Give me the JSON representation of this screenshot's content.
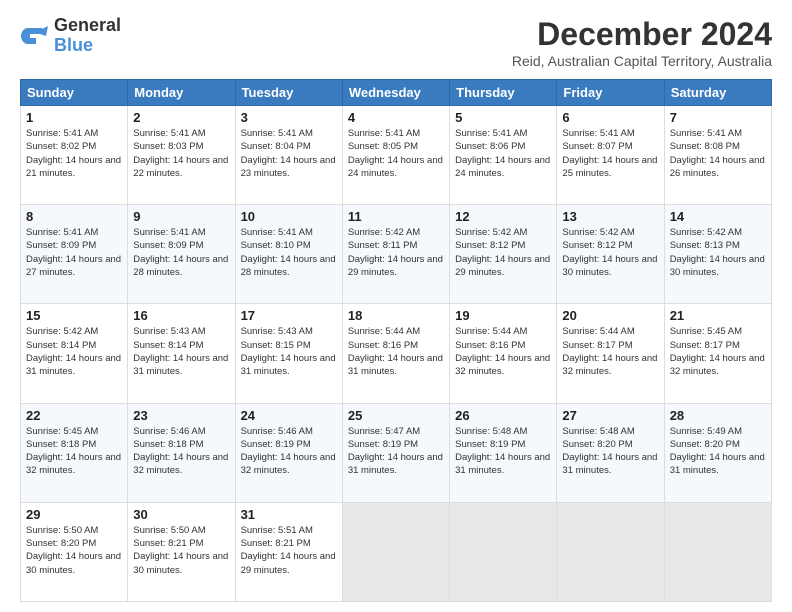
{
  "header": {
    "logo_line1": "General",
    "logo_line2": "Blue",
    "main_title": "December 2024",
    "subtitle": "Reid, Australian Capital Territory, Australia"
  },
  "calendar": {
    "days_of_week": [
      "Sunday",
      "Monday",
      "Tuesday",
      "Wednesday",
      "Thursday",
      "Friday",
      "Saturday"
    ],
    "weeks": [
      [
        {
          "day": "1",
          "sunrise": "5:41 AM",
          "sunset": "8:02 PM",
          "daylight": "14 hours and 21 minutes."
        },
        {
          "day": "2",
          "sunrise": "5:41 AM",
          "sunset": "8:03 PM",
          "daylight": "14 hours and 22 minutes."
        },
        {
          "day": "3",
          "sunrise": "5:41 AM",
          "sunset": "8:04 PM",
          "daylight": "14 hours and 23 minutes."
        },
        {
          "day": "4",
          "sunrise": "5:41 AM",
          "sunset": "8:05 PM",
          "daylight": "14 hours and 24 minutes."
        },
        {
          "day": "5",
          "sunrise": "5:41 AM",
          "sunset": "8:06 PM",
          "daylight": "14 hours and 24 minutes."
        },
        {
          "day": "6",
          "sunrise": "5:41 AM",
          "sunset": "8:07 PM",
          "daylight": "14 hours and 25 minutes."
        },
        {
          "day": "7",
          "sunrise": "5:41 AM",
          "sunset": "8:08 PM",
          "daylight": "14 hours and 26 minutes."
        }
      ],
      [
        {
          "day": "8",
          "sunrise": "5:41 AM",
          "sunset": "8:09 PM",
          "daylight": "14 hours and 27 minutes."
        },
        {
          "day": "9",
          "sunrise": "5:41 AM",
          "sunset": "8:09 PM",
          "daylight": "14 hours and 28 minutes."
        },
        {
          "day": "10",
          "sunrise": "5:41 AM",
          "sunset": "8:10 PM",
          "daylight": "14 hours and 28 minutes."
        },
        {
          "day": "11",
          "sunrise": "5:42 AM",
          "sunset": "8:11 PM",
          "daylight": "14 hours and 29 minutes."
        },
        {
          "day": "12",
          "sunrise": "5:42 AM",
          "sunset": "8:12 PM",
          "daylight": "14 hours and 29 minutes."
        },
        {
          "day": "13",
          "sunrise": "5:42 AM",
          "sunset": "8:12 PM",
          "daylight": "14 hours and 30 minutes."
        },
        {
          "day": "14",
          "sunrise": "5:42 AM",
          "sunset": "8:13 PM",
          "daylight": "14 hours and 30 minutes."
        }
      ],
      [
        {
          "day": "15",
          "sunrise": "5:42 AM",
          "sunset": "8:14 PM",
          "daylight": "14 hours and 31 minutes."
        },
        {
          "day": "16",
          "sunrise": "5:43 AM",
          "sunset": "8:14 PM",
          "daylight": "14 hours and 31 minutes."
        },
        {
          "day": "17",
          "sunrise": "5:43 AM",
          "sunset": "8:15 PM",
          "daylight": "14 hours and 31 minutes."
        },
        {
          "day": "18",
          "sunrise": "5:44 AM",
          "sunset": "8:16 PM",
          "daylight": "14 hours and 31 minutes."
        },
        {
          "day": "19",
          "sunrise": "5:44 AM",
          "sunset": "8:16 PM",
          "daylight": "14 hours and 32 minutes."
        },
        {
          "day": "20",
          "sunrise": "5:44 AM",
          "sunset": "8:17 PM",
          "daylight": "14 hours and 32 minutes."
        },
        {
          "day": "21",
          "sunrise": "5:45 AM",
          "sunset": "8:17 PM",
          "daylight": "14 hours and 32 minutes."
        }
      ],
      [
        {
          "day": "22",
          "sunrise": "5:45 AM",
          "sunset": "8:18 PM",
          "daylight": "14 hours and 32 minutes."
        },
        {
          "day": "23",
          "sunrise": "5:46 AM",
          "sunset": "8:18 PM",
          "daylight": "14 hours and 32 minutes."
        },
        {
          "day": "24",
          "sunrise": "5:46 AM",
          "sunset": "8:19 PM",
          "daylight": "14 hours and 32 minutes."
        },
        {
          "day": "25",
          "sunrise": "5:47 AM",
          "sunset": "8:19 PM",
          "daylight": "14 hours and 31 minutes."
        },
        {
          "day": "26",
          "sunrise": "5:48 AM",
          "sunset": "8:19 PM",
          "daylight": "14 hours and 31 minutes."
        },
        {
          "day": "27",
          "sunrise": "5:48 AM",
          "sunset": "8:20 PM",
          "daylight": "14 hours and 31 minutes."
        },
        {
          "day": "28",
          "sunrise": "5:49 AM",
          "sunset": "8:20 PM",
          "daylight": "14 hours and 31 minutes."
        }
      ],
      [
        {
          "day": "29",
          "sunrise": "5:50 AM",
          "sunset": "8:20 PM",
          "daylight": "14 hours and 30 minutes."
        },
        {
          "day": "30",
          "sunrise": "5:50 AM",
          "sunset": "8:21 PM",
          "daylight": "14 hours and 30 minutes."
        },
        {
          "day": "31",
          "sunrise": "5:51 AM",
          "sunset": "8:21 PM",
          "daylight": "14 hours and 29 minutes."
        },
        null,
        null,
        null,
        null
      ]
    ]
  }
}
